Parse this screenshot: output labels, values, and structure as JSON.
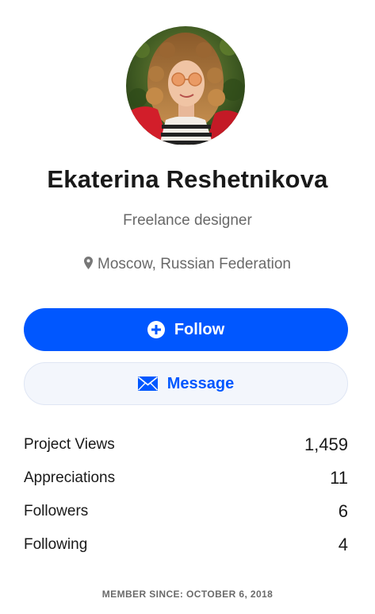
{
  "profile": {
    "name": "Ekaterina Reshetnikova",
    "occupation": "Freelance designer",
    "location": "Moscow, Russian Federation",
    "location_icon": "map-pin-icon"
  },
  "actions": {
    "follow_label": "Follow",
    "follow_icon": "plus-circle-icon",
    "message_label": "Message",
    "message_icon": "envelope-icon",
    "accent_color": "#0057ff"
  },
  "stats": [
    {
      "label": "Project Views",
      "value": "1,459"
    },
    {
      "label": "Appreciations",
      "value": "11"
    },
    {
      "label": "Followers",
      "value": "6"
    },
    {
      "label": "Following",
      "value": "4"
    }
  ],
  "footer": {
    "member_since": "MEMBER SINCE: OCTOBER 6, 2018"
  }
}
